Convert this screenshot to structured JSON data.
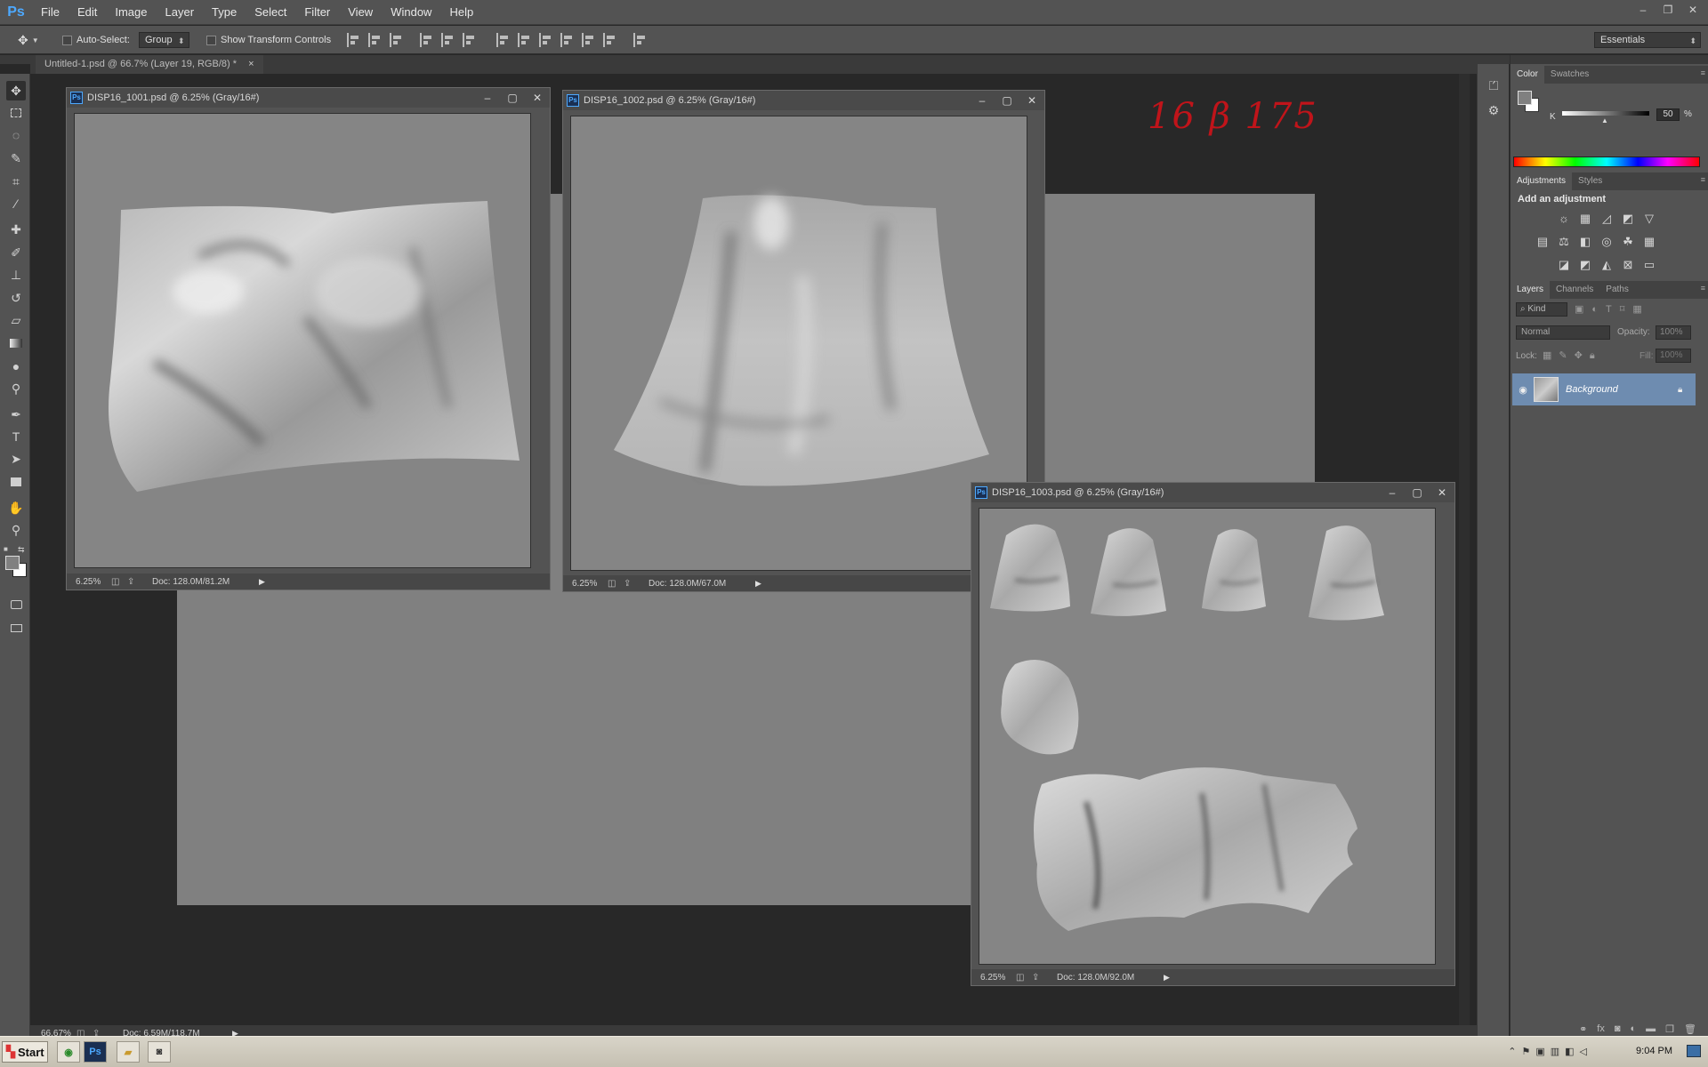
{
  "app": {
    "logo": "Ps",
    "menus": [
      "File",
      "Edit",
      "Image",
      "Layer",
      "Type",
      "Select",
      "Filter",
      "View",
      "Window",
      "Help"
    ],
    "window_controls": [
      "–",
      "❐",
      "✕"
    ]
  },
  "options_bar": {
    "auto_select_label": "Auto-Select:",
    "auto_select_value": "Group",
    "show_transform_label": "Show Transform Controls",
    "workspace": "Essentials"
  },
  "doc_tab": {
    "title": "Untitled-1.psd @ 66.7% (Layer 19, RGB/8) *",
    "close": "×"
  },
  "annotation": "16 β 175",
  "documents": [
    {
      "title": "DISP16_1001.psd @ 6.25% (Gray/16#)",
      "zoom": "6.25%",
      "doc": "Doc: 128.0M/81.2M"
    },
    {
      "title": "DISP16_1002.psd @ 6.25% (Gray/16#)",
      "zoom": "6.25%",
      "doc": "Doc: 128.0M/67.0M"
    },
    {
      "title": "DISP16_1003.psd @ 6.25% (Gray/16#)",
      "zoom": "6.25%",
      "doc": "Doc: 128.0M/92.0M"
    }
  ],
  "main_status": {
    "zoom": "66.67%",
    "doc": "Doc: 6.59M/118.7M"
  },
  "color_panel": {
    "tabs": [
      "Color",
      "Swatches"
    ],
    "channel": "K",
    "value": "50",
    "unit": "%"
  },
  "adjustments_panel": {
    "tabs": [
      "Adjustments",
      "Styles"
    ],
    "heading": "Add an adjustment"
  },
  "layers_panel": {
    "tabs": [
      "Layers",
      "Channels",
      "Paths"
    ],
    "filter": "Kind",
    "blend_mode": "Normal",
    "opacity_label": "Opacity:",
    "opacity": "100%",
    "lock_label": "Lock:",
    "fill_label": "Fill:",
    "fill": "100%",
    "layers": [
      {
        "name": "Background"
      }
    ]
  },
  "taskbar": {
    "start": "Start",
    "clock": "9:04 PM"
  }
}
